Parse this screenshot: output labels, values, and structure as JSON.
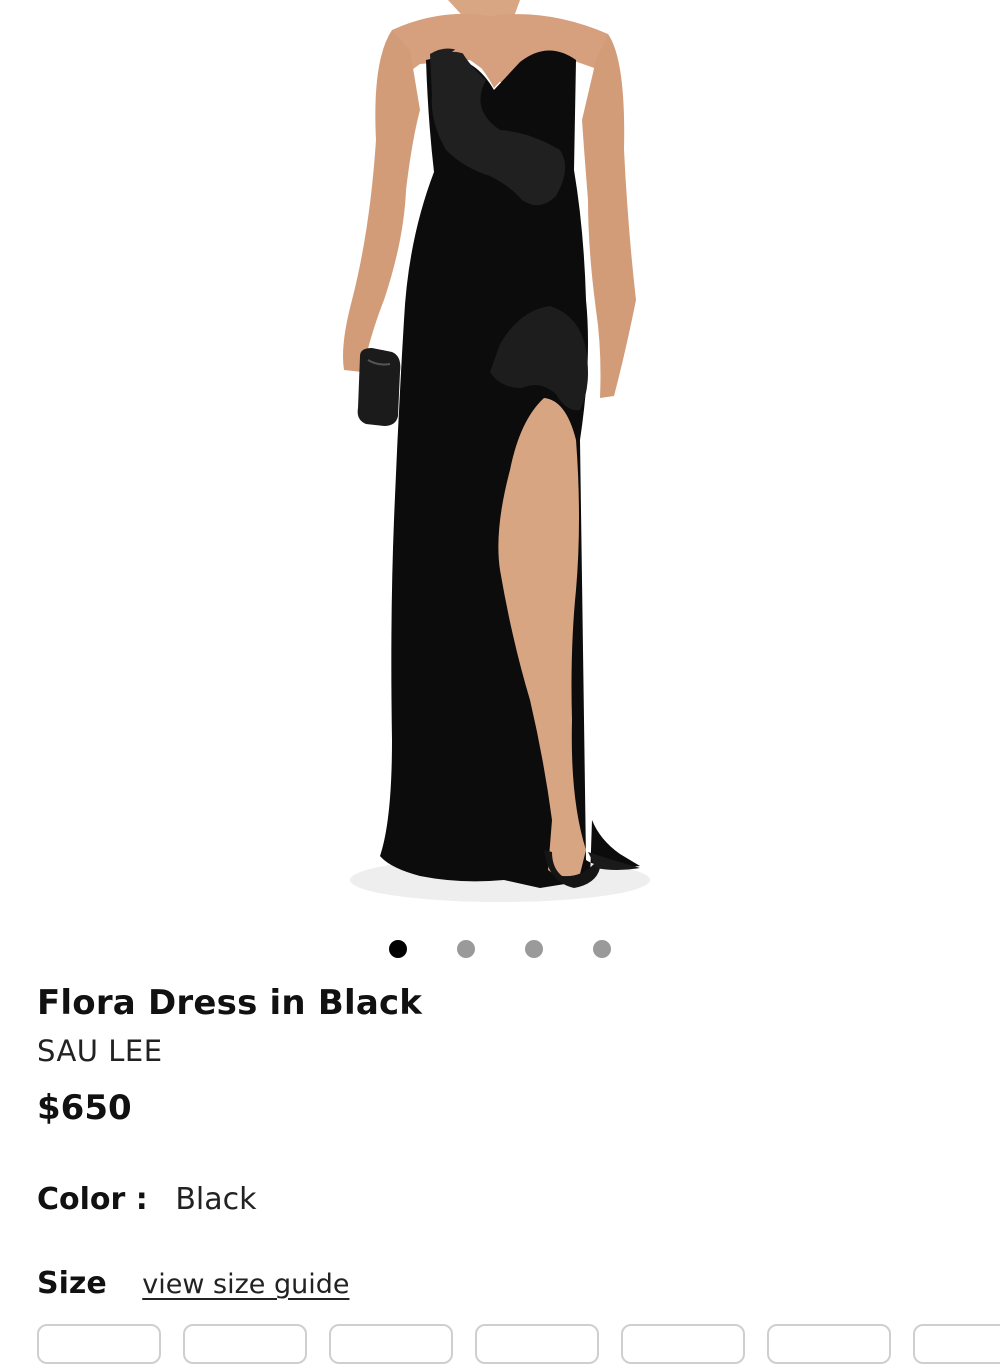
{
  "product": {
    "image_alt": "Flora Dress in Black",
    "title": "Flora Dress in Black",
    "brand": "SAU LEE",
    "price": "$650",
    "color_label": "Color :",
    "color_value": "Black",
    "size_label": "Size",
    "size_guide_label": "view size guide"
  },
  "carousel": {
    "total_images": 4,
    "active_index": 0
  },
  "colors": {
    "text": "#111111",
    "dot_active": "#000000",
    "dot_inactive": "#9a9a9a",
    "size_border": "#cfcfcf"
  }
}
